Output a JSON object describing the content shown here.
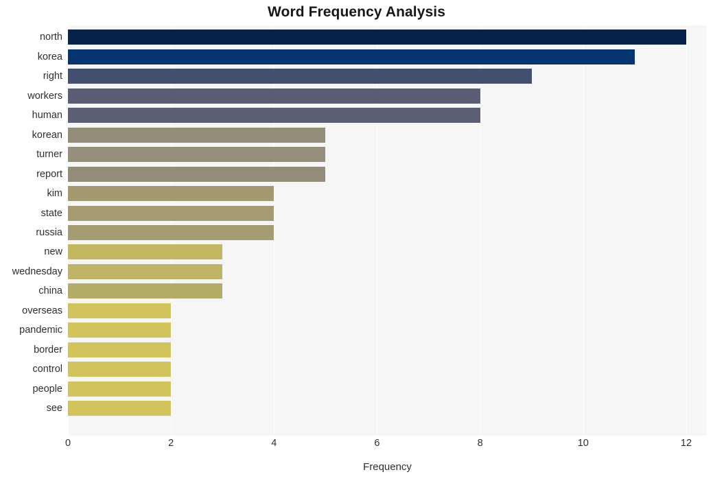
{
  "chart_data": {
    "type": "bar",
    "orientation": "horizontal",
    "title": "Word Frequency Analysis",
    "xlabel": "Frequency",
    "ylabel": "",
    "xlim": [
      0,
      12.4
    ],
    "xticks": [
      "0",
      "2",
      "4",
      "6",
      "8",
      "10",
      "12"
    ],
    "xtick_values": [
      0,
      2,
      4,
      6,
      8,
      10,
      12
    ],
    "grid": true,
    "grid_axis": "x",
    "legend": "none",
    "plot_background": "#f6f6f7",
    "gridline_color": "#ffffff",
    "categories": [
      "north",
      "korea",
      "right",
      "workers",
      "human",
      "korean",
      "turner",
      "report",
      "kim",
      "state",
      "russia",
      "new",
      "wednesday",
      "china",
      "overseas",
      "pandemic",
      "border",
      "control",
      "people",
      "see"
    ],
    "values": [
      12,
      11,
      9,
      8,
      8,
      5,
      5,
      5,
      4,
      4,
      4,
      3,
      3,
      3,
      2,
      2,
      2,
      2,
      2,
      2
    ],
    "bar_colors": [
      "#05224b",
      "#053570",
      "#44506f",
      "#595e74",
      "#5a5f76",
      "#948d79",
      "#958e7a",
      "#938c78",
      "#a39a6f",
      "#a49c70",
      "#a59d71",
      "#c3b85f",
      "#bfb463",
      "#b4ab68",
      "#d2c45a",
      "#d2c45a",
      "#d2c45a",
      "#d2c45a",
      "#d2c45a",
      "#d2c45a"
    ]
  }
}
